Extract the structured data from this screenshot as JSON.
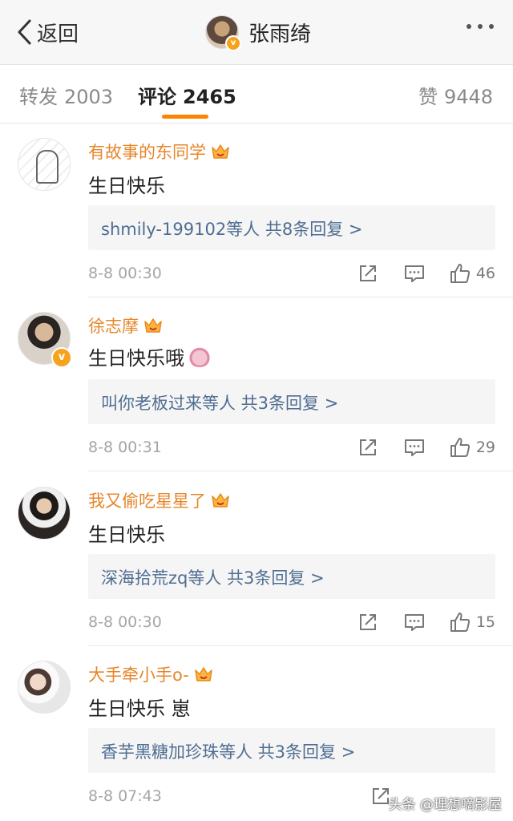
{
  "topbar": {
    "back_label": "返回",
    "title": "张雨绮",
    "verified_mark": "v"
  },
  "tabs": [
    {
      "label": "转发",
      "count": "2003"
    },
    {
      "label": "评论",
      "count": "2465"
    },
    {
      "label": "赞",
      "count": "9448"
    }
  ],
  "comments": [
    {
      "name": "有故事的东同学",
      "text": "生日快乐",
      "replies": "shmily-199102等人  共8条回复 >",
      "time": "8-8 00:30",
      "likes": "46"
    },
    {
      "name": "徐志摩",
      "text": "生日快乐哦",
      "replies": "叫你老板过来等人  共3条回复 >",
      "time": "8-8 00:31",
      "likes": "29",
      "verified_mark": "v"
    },
    {
      "name": "我又偷吃星星了",
      "text": "生日快乐",
      "replies": "深海拾荒zq等人  共3条回复 >",
      "time": "8-8 00:30",
      "likes": "15"
    },
    {
      "name": "大手牵小手o-",
      "text": "生日快乐 崽",
      "replies": "香芋黑糖加珍珠等人  共3条回复 >",
      "time": "8-8 07:43",
      "likes": ""
    }
  ],
  "icons": {
    "back": "chevron-left-icon",
    "more": "more-dots-icon",
    "crown": "crown-badge-icon",
    "share": "share-icon",
    "comment": "comment-icon",
    "like": "thumbs-up-icon",
    "sticker": "pink-creature-emoji-icon"
  },
  "colors": {
    "accent": "#ff8200",
    "username": "#e7862a",
    "reply_link": "#4f6e92",
    "verified": "#f7a21c"
  },
  "watermark": "头条 @理想嘀影屋"
}
